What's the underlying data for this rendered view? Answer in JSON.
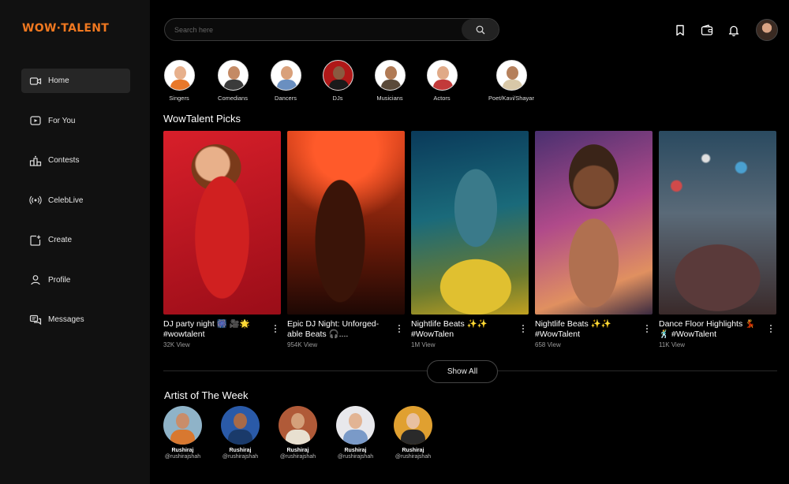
{
  "brand": {
    "logo_text": "WOW·TALENT",
    "accent": "#f07820"
  },
  "sidebar": {
    "items": [
      {
        "label": "Home",
        "icon": "video-camera-icon",
        "active": true
      },
      {
        "label": "For You",
        "icon": "play-box-icon"
      },
      {
        "label": "Contests",
        "icon": "podium-icon"
      },
      {
        "label": "CelebLive",
        "icon": "live-broadcast-icon"
      },
      {
        "label": "Create",
        "icon": "create-plus-icon"
      },
      {
        "label": "Profile",
        "icon": "user-icon"
      },
      {
        "label": "Messages",
        "icon": "chat-icon"
      }
    ]
  },
  "search": {
    "placeholder": "Search here",
    "value": ""
  },
  "header_icons": [
    "bookmark-icon",
    "wallet-icon",
    "bell-icon",
    "profile-avatar"
  ],
  "categories": [
    {
      "label": "Singers"
    },
    {
      "label": "Comedians"
    },
    {
      "label": "Dancers"
    },
    {
      "label": "DJs"
    },
    {
      "label": "Musicians"
    },
    {
      "label": "Actors"
    },
    {
      "label": "Poet/Kavi/Shayar"
    }
  ],
  "picks": {
    "title": "WowTalent Picks",
    "items": [
      {
        "title": "DJ party night 🎆 🎥🌟 #wowtalent",
        "views": "32K View"
      },
      {
        "title": "Epic DJ Night: Unforged- able Beats 🎧....",
        "views": "954K View"
      },
      {
        "title": "Nightlife Beats ✨✨ #WowTalen",
        "views": "1M View"
      },
      {
        "title": "Nightlife Beats ✨✨ #WowTalent",
        "views": "658 View"
      },
      {
        "title": "Dance Floor Highlights 💃🕺 #WowTalent",
        "views": "11K View"
      }
    ],
    "show_all_label": "Show All"
  },
  "artists": {
    "title": "Artist of The Week",
    "items": [
      {
        "name": "Rushiraj",
        "handle": "@rushirajshah"
      },
      {
        "name": "Rushiraj",
        "handle": "@rushirajshah"
      },
      {
        "name": "Rushiraj",
        "handle": "@rushirajshah"
      },
      {
        "name": "Rushiraj",
        "handle": "@rushirajshah"
      },
      {
        "name": "Rushiraj",
        "handle": "@rushirajshah"
      }
    ]
  }
}
